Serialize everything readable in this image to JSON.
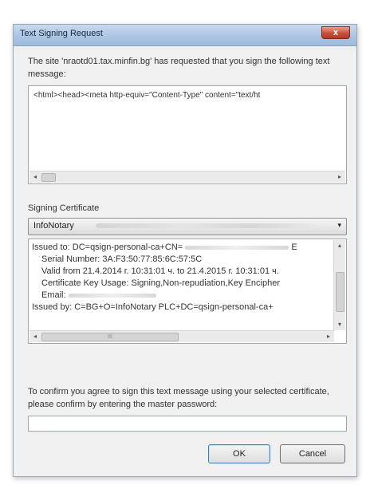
{
  "window": {
    "title": "Text Signing Request",
    "close_label": "x"
  },
  "request": {
    "intro": "The site 'nraotd01.tax.minfin.bg' has requested that you sign the following text message:",
    "message": "<html><head><meta http-equiv=\"Content-Type\" content=\"text/ht"
  },
  "certificate": {
    "label": "Signing Certificate",
    "selected": "InfoNotary",
    "details": {
      "issued_to": "Issued to: DC=qsign-personal-ca+CN=",
      "issued_to_tail": "E",
      "serial": "Serial Number: 3A:F3:50:77:85:6C:57:5C",
      "valid": "Valid from 21.4.2014 г. 10:31:01 ч. to 21.4.2015 г. 10:31:01 ч.",
      "key_usage": "Certificate Key Usage: Signing,Non-repudiation,Key Encipher",
      "email": "Email:",
      "issued_by": "Issued by: C=BG+O=InfoNotary PLC+DC=qsign-personal-ca+"
    }
  },
  "confirm": {
    "text": "To confirm you agree to sign this text message using your selected certificate, please confirm by entering the master password:",
    "password_value": ""
  },
  "buttons": {
    "ok": "OK",
    "cancel": "Cancel"
  },
  "scrollbar_glyphs": {
    "left": "◂",
    "right": "▸",
    "up": "▴",
    "down": "▾",
    "thumb_grip": "III"
  }
}
